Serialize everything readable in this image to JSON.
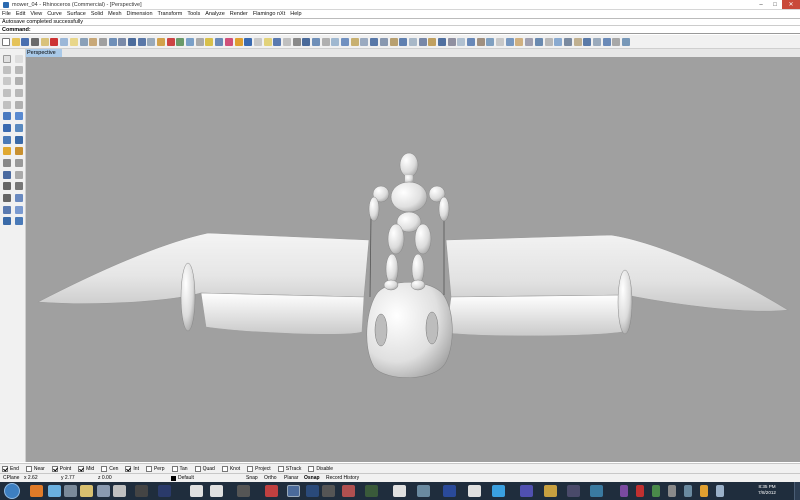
{
  "window": {
    "title": "mower_04 - Rhinoceros (Commercial) - [Perspective]",
    "minimize_label": "–",
    "maximize_label": "□",
    "close_label": "✕"
  },
  "menu": [
    "File",
    "Edit",
    "View",
    "Curve",
    "Surface",
    "Solid",
    "Mesh",
    "Dimension",
    "Transform",
    "Tools",
    "Analyze",
    "Render",
    "Flamingo nXt",
    "Help"
  ],
  "command_history": "Autosave completed successfully",
  "command_prompt": {
    "label": "Command:",
    "value": ""
  },
  "viewport": {
    "tab_label": "Perspective",
    "background": "#a0a0a0"
  },
  "osnap": [
    {
      "label": "End",
      "checked": true
    },
    {
      "label": "Near",
      "checked": false
    },
    {
      "label": "Point",
      "checked": true
    },
    {
      "label": "Mid",
      "checked": true
    },
    {
      "label": "Cen",
      "checked": false
    },
    {
      "label": "Int",
      "checked": true
    },
    {
      "label": "Perp",
      "checked": false
    },
    {
      "label": "Tan",
      "checked": false
    },
    {
      "label": "Quad",
      "checked": false
    },
    {
      "label": "Knot",
      "checked": false
    },
    {
      "label": "Project",
      "checked": false
    },
    {
      "label": "STrack",
      "checked": false
    },
    {
      "label": "Disable",
      "checked": false
    }
  ],
  "status": {
    "cplane": "CPlane",
    "x": "x 2.62",
    "y": "y 2.77",
    "z": "z 0.00",
    "layer": "Default",
    "snap": "Snap",
    "ortho": "Ortho",
    "planar": "Planar",
    "osnap": "Osnap",
    "record_history": "Record History"
  },
  "clock": {
    "time": "8:35 PM",
    "date": "7/8/2012"
  },
  "colors": {
    "accent": "#a9c9e8",
    "taskbar": "#1f2d3d",
    "close_button": "#c94a3a"
  }
}
